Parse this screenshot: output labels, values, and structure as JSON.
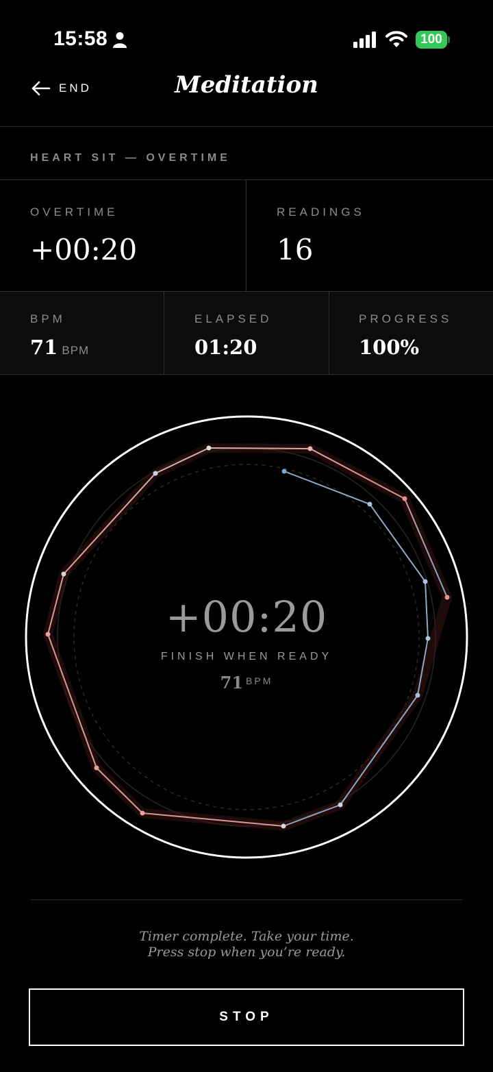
{
  "status_bar": {
    "time": "15:58",
    "battery": "100"
  },
  "header": {
    "back_label": "END",
    "title": "Meditation"
  },
  "session": {
    "label": "HEART SIT — OVERTIME"
  },
  "stats_top": {
    "overtime": {
      "label": "OVERTIME",
      "value": "+00:20"
    },
    "readings": {
      "label": "READINGS",
      "value": "16"
    }
  },
  "stats_row": {
    "bpm": {
      "label": "BPM",
      "value": "71",
      "unit": "BPM"
    },
    "elapsed": {
      "label": "ELAPSED",
      "value": "01:20"
    },
    "progress": {
      "label": "PROGRESS",
      "value": "100%"
    }
  },
  "ring": {
    "time": "+00:20",
    "subtitle": "FINISH WHEN READY",
    "bpm": "71",
    "bpm_unit": "BPM",
    "progress": 1.0,
    "colors": {
      "cool": "#7fa6cf",
      "warm": "#e2968c",
      "neutral": "#c9c9c9"
    }
  },
  "message": {
    "line1": "Timer complete. Take your time.",
    "line2": "Press stop when you’re ready."
  },
  "stop_button": {
    "label": "STOP"
  }
}
